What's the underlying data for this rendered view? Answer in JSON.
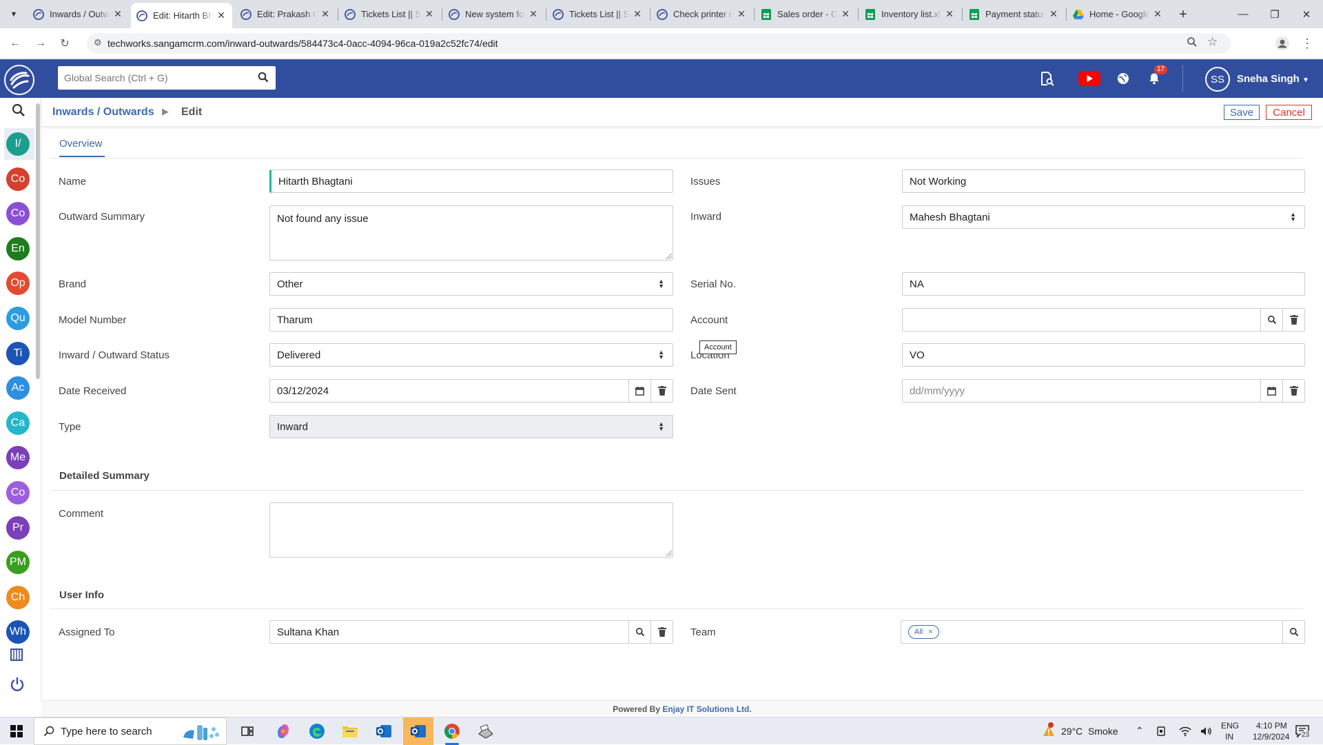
{
  "browser": {
    "tabs": [
      {
        "title": "Inwards / Outwards",
        "icon": "sangam-icon"
      },
      {
        "title": "Edit: Hitarth Bhagtani",
        "icon": "sangam-icon",
        "active": true
      },
      {
        "title": "Edit: Prakash Chauhan",
        "icon": "sangam-icon"
      },
      {
        "title": "Tickets List || Sangam",
        "icon": "sangam-icon"
      },
      {
        "title": "New system for",
        "icon": "sangam-icon"
      },
      {
        "title": "Tickets List || Sangam",
        "icon": "sangam-icon"
      },
      {
        "title": "Check printer issue",
        "icon": "sangam-icon"
      },
      {
        "title": "Sales order - Google",
        "icon": "sheets-icon"
      },
      {
        "title": "Inventory list.xlsx",
        "icon": "sheets-icon"
      },
      {
        "title": "Payment status",
        "icon": "sheets-icon"
      },
      {
        "title": "Home - Google Drive",
        "icon": "drive-icon"
      }
    ],
    "url": "techworks.sangamcrm.com/inward-outwards/584473c4-0acc-4094-96ca-019a2c52fc74/edit"
  },
  "header": {
    "search_placeholder": "Global Search (Ctrl + G)",
    "notification_count": "17",
    "user_initials": "SS",
    "user_name": "Sneha Singh"
  },
  "sidebar": {
    "items": [
      {
        "label": "I/",
        "color": "#1b9e8e"
      },
      {
        "label": "Co",
        "color": "#d6402f"
      },
      {
        "label": "Co",
        "color": "#8a4fd6"
      },
      {
        "label": "En",
        "color": "#1e7d1e"
      },
      {
        "label": "Op",
        "color": "#e5492f"
      },
      {
        "label": "Qu",
        "color": "#2d9be0"
      },
      {
        "label": "Ti",
        "color": "#1c54b5"
      },
      {
        "label": "Ac",
        "color": "#2d8fe0"
      },
      {
        "label": "Ca",
        "color": "#26b6c9"
      },
      {
        "label": "Me",
        "color": "#7b3fb8"
      },
      {
        "label": "Co",
        "color": "#9c5ee0"
      },
      {
        "label": "Pr",
        "color": "#7b3fb8"
      },
      {
        "label": "PM",
        "color": "#3a9e1e"
      },
      {
        "label": "Ch",
        "color": "#ef8a1d"
      },
      {
        "label": "Wh",
        "color": "#1c54b5"
      }
    ]
  },
  "breadcrumb": {
    "module": "Inwards / Outwards",
    "current": "Edit"
  },
  "actions": {
    "save": "Save",
    "cancel": "Cancel"
  },
  "tabs": {
    "overview": "Overview"
  },
  "form": {
    "name": {
      "label": "Name",
      "value": "Hitarth Bhagtani"
    },
    "issues": {
      "label": "Issues",
      "value": "Not Working"
    },
    "outward_summary": {
      "label": "Outward Summary",
      "value": "Not found any issue"
    },
    "inward": {
      "label": "Inward",
      "value": "Mahesh Bhagtani"
    },
    "brand": {
      "label": "Brand",
      "value": "Other"
    },
    "serial_no": {
      "label": "Serial No.",
      "value": "NA"
    },
    "model_number": {
      "label": "Model Number",
      "value": "Tharum"
    },
    "account": {
      "label": "Account",
      "value": "",
      "tooltip": "Account"
    },
    "status": {
      "label": "Inward / Outward Status",
      "value": "Delivered"
    },
    "location": {
      "label": "Location",
      "value": "VO"
    },
    "date_received": {
      "label": "Date Received",
      "value": "03/12/2024"
    },
    "date_sent": {
      "label": "Date Sent",
      "value": "",
      "placeholder": "dd/mm/yyyy"
    },
    "type": {
      "label": "Type",
      "value": "Inward"
    }
  },
  "detailed_summary": {
    "title": "Detailed Summary",
    "comment": {
      "label": "Comment",
      "value": ""
    }
  },
  "user_info": {
    "title": "User Info",
    "assigned_to": {
      "label": "Assigned To",
      "value": "Sultana Khan"
    },
    "team": {
      "label": "Team",
      "chip": "All"
    }
  },
  "footer": {
    "prefix": "Powered By",
    "company": "Enjay IT Solutions Ltd."
  },
  "taskbar": {
    "search_placeholder": "Type here to search",
    "weather": "29°C  Smoke",
    "lang_top": "ENG",
    "lang_bottom": "IN",
    "time": "4:10 PM",
    "date": "12/9/2024",
    "notif_count": "23"
  }
}
